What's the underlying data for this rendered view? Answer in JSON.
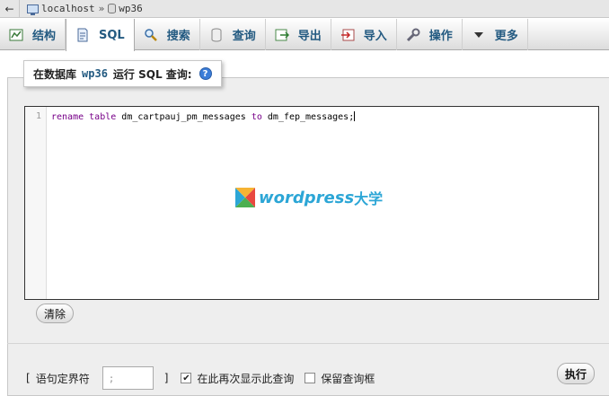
{
  "breadcrumb": {
    "back_glyph": "←",
    "server": "localhost",
    "separator": "»",
    "database": "wp36"
  },
  "tabs": [
    {
      "label": "结构",
      "icon": "structure-icon"
    },
    {
      "label": "SQL",
      "icon": "sql-icon"
    },
    {
      "label": "搜索",
      "icon": "search-icon"
    },
    {
      "label": "查询",
      "icon": "query-icon"
    },
    {
      "label": "导出",
      "icon": "export-icon"
    },
    {
      "label": "导入",
      "icon": "import-icon"
    },
    {
      "label": "操作",
      "icon": "wrench-icon"
    },
    {
      "label": "更多",
      "icon": "caret-down-icon"
    }
  ],
  "legend": {
    "prefix": "在数据库",
    "database": "wp36",
    "suffix": "运行 SQL 查询:",
    "help_glyph": "?"
  },
  "editor": {
    "line_number": "1",
    "code": {
      "kw1": "rename",
      "kw2": "table",
      "t1": "dm_cartpauj_pm_messages",
      "kw3": "to",
      "t2": "dm_fep_messages;"
    }
  },
  "watermark": {
    "text": "wordpress",
    "cn": "大学"
  },
  "buttons": {
    "clear": "清除",
    "go": "执行"
  },
  "options": {
    "delimiter_label": "语句定界符",
    "bracket_open": "[",
    "bracket_close": "]",
    "delimiter_value": ";",
    "show_again_label": "在此再次显示此查询",
    "show_again_checked": true,
    "retain_box_label": "保留查询框",
    "retain_box_checked": false
  },
  "colors": {
    "accent": "#235a81",
    "watermark": "#2ca6d6"
  }
}
